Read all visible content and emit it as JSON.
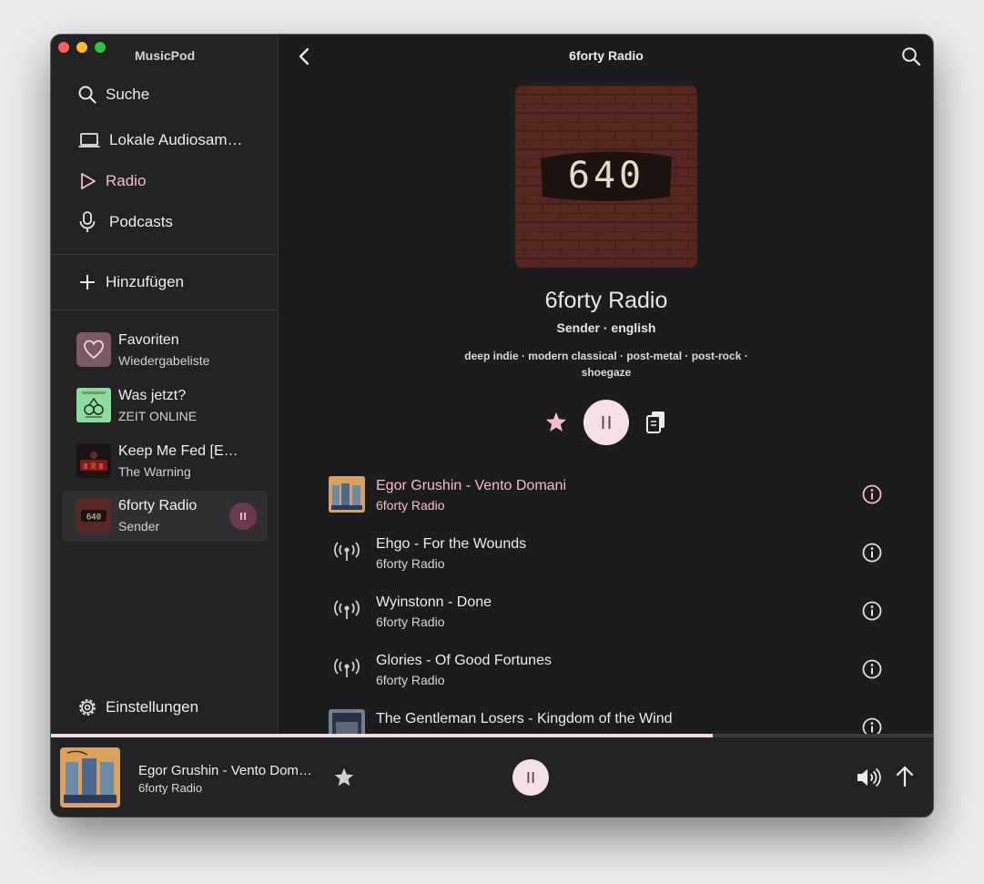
{
  "app": {
    "title": "MusicPod"
  },
  "sidebar": {
    "nav": [
      {
        "label": "Suche",
        "icon": "search-icon"
      },
      {
        "label": "Lokale Audiosam…",
        "icon": "laptop-icon"
      },
      {
        "label": "Radio",
        "icon": "play-triangle-icon"
      },
      {
        "label": "Podcasts",
        "icon": "microphone-icon"
      }
    ],
    "add_label": "Hinzufügen",
    "library": [
      {
        "title": "Favoriten",
        "subtitle": "Wiedergabeliste"
      },
      {
        "title": "Was jetzt?",
        "subtitle": "ZEIT ONLINE"
      },
      {
        "title": "Keep Me Fed [E…",
        "subtitle": "The Warning"
      },
      {
        "title": "6forty Radio",
        "subtitle": "Sender"
      }
    ],
    "settings_label": "Einstellungen"
  },
  "header": {
    "title": "6forty Radio"
  },
  "station": {
    "cover_text": "640",
    "name": "6forty Radio",
    "meta": "Sender · english",
    "tags": "deep indie · modern classical · post-metal · post-rock · shoegaze"
  },
  "tracks": [
    {
      "title": "Egor Grushin - Vento Domani",
      "subtitle": "6forty Radio",
      "playing": true
    },
    {
      "title": "Ehgo - For the Wounds",
      "subtitle": "6forty Radio",
      "playing": false
    },
    {
      "title": "Wyinstonn - Done",
      "subtitle": "6forty Radio",
      "playing": false
    },
    {
      "title": "Glories - Of Good Fortunes",
      "subtitle": "6forty Radio",
      "playing": false
    },
    {
      "title": "The Gentleman Losers - Kingdom of the Wind",
      "subtitle": "",
      "playing": false
    }
  ],
  "player": {
    "title": "Egor Grushin - Vento Domani",
    "subtitle": "6forty Radio",
    "progress": 0.75
  },
  "colors": {
    "accent": "#f5bcd0",
    "play_button": "#f3e1e5",
    "window_bg": "#1c1c1e",
    "sidebar_bg": "#232325"
  }
}
